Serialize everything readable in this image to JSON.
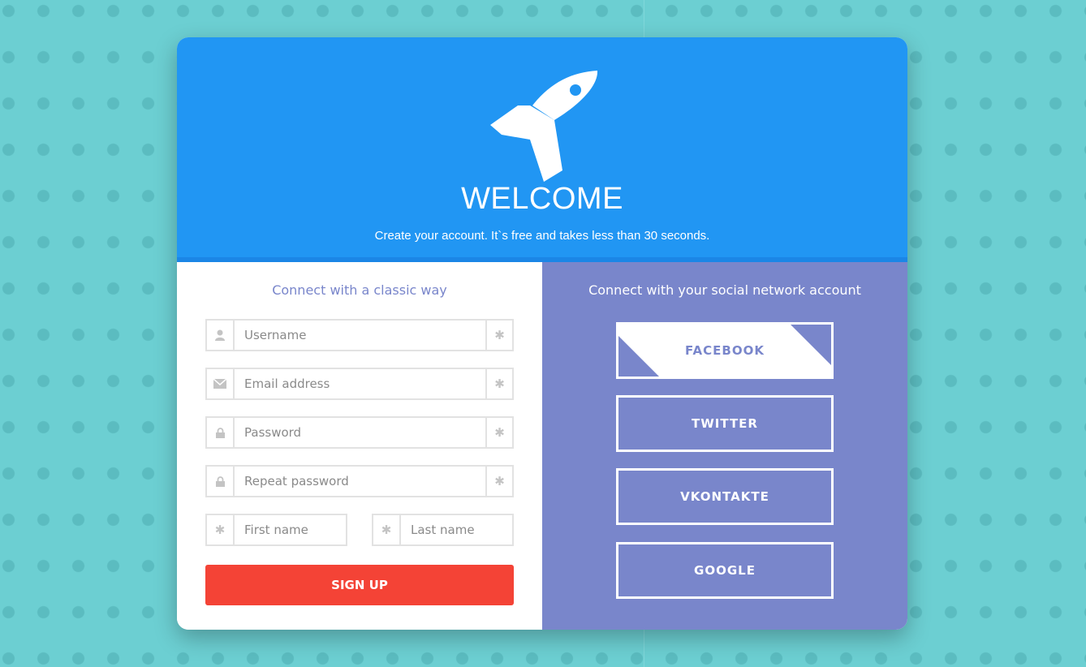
{
  "header": {
    "title": "WELCOME",
    "subtitle": "Create your account. It`s free and takes less than 30 seconds."
  },
  "classic": {
    "title": "Connect with a classic way",
    "fields": {
      "username": {
        "placeholder": "Username",
        "icon": "user-icon"
      },
      "email": {
        "placeholder": "Email address",
        "icon": "envelope-icon"
      },
      "password": {
        "placeholder": "Password",
        "icon": "lock-icon"
      },
      "repeat_password": {
        "placeholder": "Repeat password",
        "icon": "lock-icon"
      },
      "first_name": {
        "placeholder": "First name",
        "icon": "asterisk-icon"
      },
      "last_name": {
        "placeholder": "Last name",
        "icon": "asterisk-icon"
      }
    },
    "required_marker": "✱",
    "signup_label": "SIGN UP"
  },
  "social": {
    "title": "Connect with your social network account",
    "buttons": [
      "FACEBOOK",
      "TWITTER",
      "VKONTAKTE",
      "GOOGLE"
    ]
  },
  "colors": {
    "background": "#6ccfd2",
    "header": "#2196f3",
    "social_panel": "#7986cb",
    "signup": "#f44336"
  }
}
